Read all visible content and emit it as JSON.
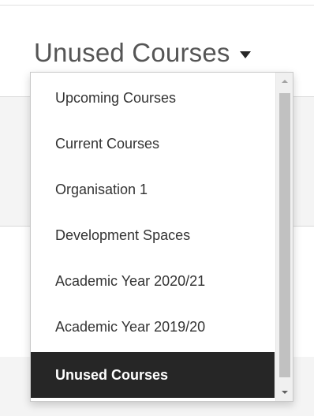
{
  "selector": {
    "current_value": "Unused Courses",
    "arrow_icon": "caret-down-icon"
  },
  "dropdown": {
    "options": [
      {
        "label": "Upcoming Courses",
        "selected": false
      },
      {
        "label": "Current Courses",
        "selected": false
      },
      {
        "label": "Organisation 1",
        "selected": false
      },
      {
        "label": "Development Spaces",
        "selected": false
      },
      {
        "label": "Academic Year 2020/21",
        "selected": false
      },
      {
        "label": "Academic Year 2019/20",
        "selected": false
      },
      {
        "label": "Unused Courses",
        "selected": true
      }
    ]
  },
  "colors": {
    "selected_background": "#262626",
    "selected_text": "#ffffff",
    "option_text": "#333333",
    "trigger_text": "#555555"
  }
}
